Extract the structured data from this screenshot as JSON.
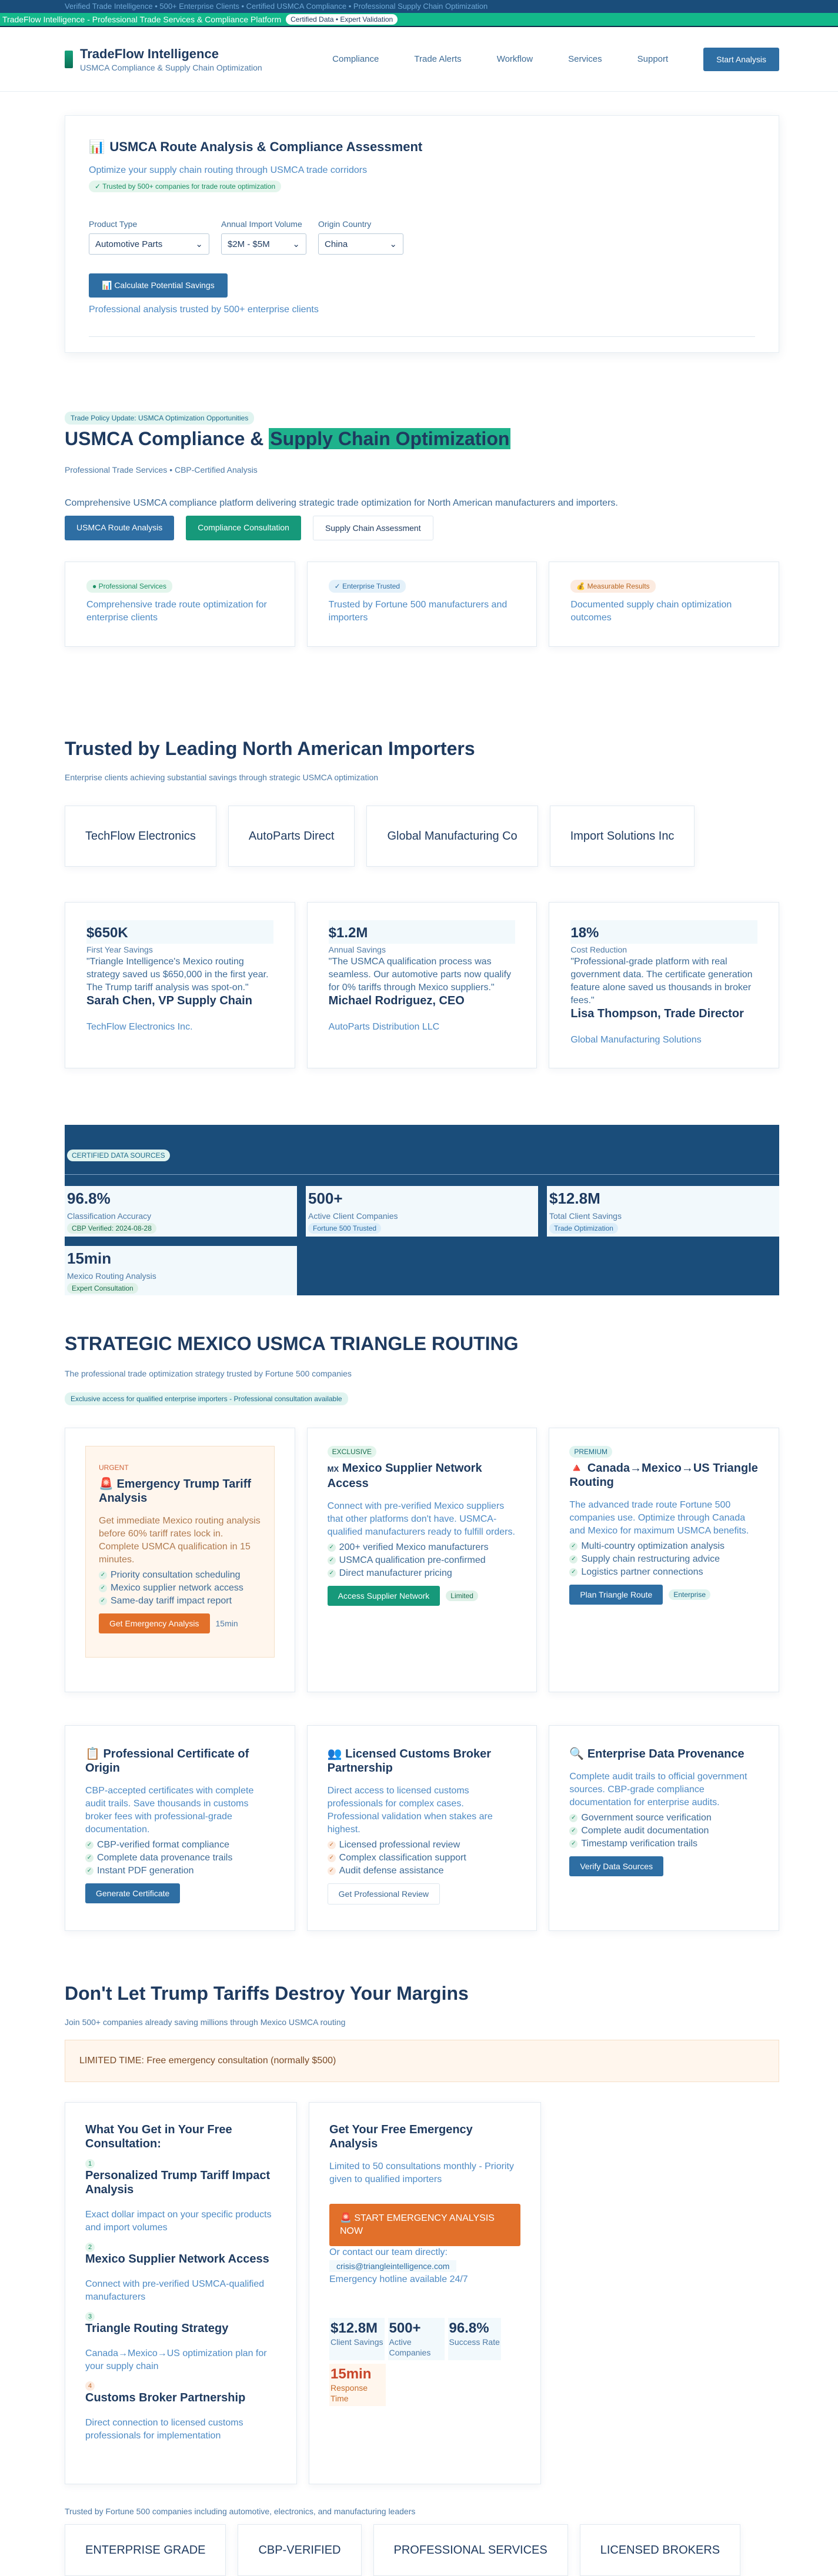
{
  "ribbons": {
    "top_text": "Verified Trade Intelligence • 500+ Enterprise Clients • Certified USMCA Compliance • Professional Supply Chain Optimization",
    "second_text": "TradeFlow Intelligence - Professional Trade Services & Compliance Platform",
    "second_chip": "Certified Data • Expert Validation"
  },
  "header": {
    "brand_name": "TradeFlow Intelligence",
    "brand_sub": "USMCA Compliance & Supply Chain Optimization",
    "nav": [
      "Compliance",
      "Trade Alerts",
      "Workflow",
      "Services",
      "Support"
    ],
    "cta": "Start Analysis"
  },
  "analysis": {
    "icon": "📊",
    "title": "USMCA Route Analysis & Compliance Assessment",
    "subtitle": "Optimize your supply chain routing through USMCA trade corridors",
    "trust_tag": "✓ Trusted by 500+ companies for trade route optimization",
    "fields": [
      {
        "label": "Product Type",
        "value": "Automotive Parts"
      },
      {
        "label": "Annual Import Volume",
        "value": "$2M - $5M"
      },
      {
        "label": "Origin Country",
        "value": "China"
      }
    ],
    "button": "📊 Calculate Potential Savings",
    "note": "Professional analysis trusted by 500+ enterprise clients"
  },
  "hero": {
    "badge": "Trade Policy Update: USMCA Optimization Opportunities",
    "title_a": "USMCA Compliance & ",
    "title_b": "Supply Chain Optimization",
    "meta": "Professional Trade Services • CBP-Certified Analysis",
    "desc": "Comprehensive USMCA compliance platform delivering strategic trade optimization for North American manufacturers and importers.",
    "buttons": [
      "USMCA Route Analysis",
      "Compliance Consultation",
      "Supply Chain Assessment"
    ],
    "features": [
      {
        "chip": "Professional Services",
        "text": "Comprehensive trade route optimization for enterprise clients"
      },
      {
        "chip": "Enterprise Trusted",
        "text": "Trusted by Fortune 500 manufacturers and importers"
      },
      {
        "chip": "Measurable Results",
        "text": "Documented supply chain optimization outcomes"
      }
    ]
  },
  "trusted": {
    "title": "Trusted by Leading North American Importers",
    "subtitle": "Enterprise clients achieving substantial savings through strategic USMCA optimization",
    "logos": [
      "TechFlow Electronics",
      "AutoParts Direct",
      "Global Manufacturing Co",
      "Import Solutions Inc"
    ],
    "testimonials": [
      {
        "value": "$650K",
        "label": "First Year Savings",
        "quote": "\"Triangle Intelligence's Mexico routing strategy saved us $650,000 in the first year. The Trump tariff analysis was spot-on.\"",
        "name": "Sarah Chen, VP Supply Chain",
        "company": "TechFlow Electronics Inc."
      },
      {
        "value": "$1.2M",
        "label": "Annual Savings",
        "quote": "\"The USMCA qualification process was seamless. Our automotive parts now qualify for 0% tariffs through Mexico suppliers.\"",
        "name": "Michael Rodriguez, CEO",
        "company": "AutoParts Distribution LLC"
      },
      {
        "value": "18%",
        "label": "Cost Reduction",
        "quote": "\"Professional-grade platform with real government data. The certificate generation feature alone saved us thousands in broker fees.\"",
        "name": "Lisa Thompson, Trade Director",
        "company": "Global Manufacturing Solutions"
      }
    ]
  },
  "data_band": {
    "chip": "CERTIFIED DATA SOURCES",
    "stats": [
      {
        "value": "96.8%",
        "label": "Classification Accuracy",
        "tag": "CBP Verified: 2024-08-28"
      },
      {
        "value": "500+",
        "label": "Active Client Companies",
        "tag": "Fortune 500 Trusted"
      },
      {
        "value": "$12.8M",
        "label": "Total Client Savings",
        "tag": "Trade Optimization"
      },
      {
        "value": "15min",
        "label": "Mexico Routing Analysis",
        "tag": "Expert Consultation"
      }
    ]
  },
  "strategic": {
    "title": "STRATEGIC MEXICO USMCA TRIANGLE ROUTING",
    "subtitle": "The professional trade optimization strategy trusted by Fortune 500 companies",
    "chip": "Exclusive access for qualified enterprise importers - Professional consultation available",
    "services": [
      {
        "badge": "URGENT",
        "icon": "🚨",
        "title": "Emergency Trump Tariff Analysis",
        "desc": "Get immediate Mexico routing analysis before 60% tariff rates lock in. Complete USMCA qualification in 15 minutes.",
        "items": [
          "Priority consultation scheduling",
          "Mexico supplier network access",
          "Same-day tariff impact report"
        ],
        "button": "Get Emergency Analysis",
        "note": "15min"
      },
      {
        "badge": "EXCLUSIVE",
        "icon": "MX",
        "title": "Mexico Supplier Network Access",
        "desc": "Connect with pre-verified Mexico suppliers that other platforms don't have. USMCA-qualified manufacturers ready to fulfill orders.",
        "items": [
          "200+ verified Mexico manufacturers",
          "USMCA qualification pre-confirmed",
          "Direct manufacturer pricing"
        ],
        "button": "Access Supplier Network",
        "note": "Limited"
      },
      {
        "badge": "PREMIUM",
        "icon": "🔺",
        "title": "Canada→Mexico→US Triangle Routing",
        "desc": "The advanced trade route Fortune 500 companies use. Optimize through Canada and Mexico for maximum USMCA benefits.",
        "items": [
          "Multi-country optimization analysis",
          "Supply chain restructuring advice",
          "Logistics partner connections"
        ],
        "button": "Plan Triangle Route",
        "note": "Enterprise"
      }
    ],
    "services2": [
      {
        "icon": "📋",
        "title": "Professional Certificate of Origin",
        "desc": "CBP-accepted certificates with complete audit trails. Save thousands in customs broker fees with professional-grade documentation.",
        "items": [
          "CBP-verified format compliance",
          "Complete data provenance trails",
          "Instant PDF generation"
        ],
        "button": "Generate Certificate"
      },
      {
        "icon": "👥",
        "title": "Licensed Customs Broker Partnership",
        "desc": "Direct access to licensed customs professionals for complex cases. Professional validation when stakes are highest.",
        "items": [
          "Licensed professional review",
          "Complex classification support",
          "Audit defense assistance"
        ],
        "button": "Get Professional Review"
      },
      {
        "icon": "🔍",
        "title": "Enterprise Data Provenance",
        "desc": "Complete audit trails to official government sources. CBP-grade compliance documentation for enterprise audits.",
        "items": [
          "Government source verification",
          "Complete audit documentation",
          "Timestamp verification trails"
        ],
        "button": "Verify Data Sources"
      }
    ]
  },
  "dontlet": {
    "title": "Don't Let Trump Tariffs Destroy Your Margins",
    "subtitle": "Join 500+ companies already saving millions through Mexico USMCA routing",
    "limited": "LIMITED TIME: Free emergency consultation (normally $500)",
    "left_title": "What You Get in Your Free Consultation:",
    "steps": [
      {
        "num": "1",
        "title": "Personalized Trump Tariff Impact Analysis",
        "desc": "Exact dollar impact on your specific products and import volumes"
      },
      {
        "num": "2",
        "title": "Mexico Supplier Network Access",
        "desc": "Connect with pre-verified USMCA-qualified manufacturers"
      },
      {
        "num": "3",
        "title": "Triangle Routing Strategy",
        "desc": "Canada→Mexico→US optimization plan for your supply chain"
      },
      {
        "num": "4",
        "title": "Customs Broker Partnership",
        "desc": "Direct connection to licensed customs professionals for implementation"
      }
    ],
    "right_title": "Get Your Free Emergency Analysis",
    "right_sub": "Limited to 50 consultations monthly - Priority given to qualified importers",
    "cta": "🚨 START EMERGENCY ANALYSIS NOW",
    "contact_label": "Or contact our team directly:",
    "email": "crisis@triangleintelligence.com",
    "hotline": "Emergency hotline available 24/7",
    "stats": [
      {
        "value": "$12.8M",
        "label": "Client Savings"
      },
      {
        "value": "500+",
        "label": "Active Companies"
      },
      {
        "value": "96.8%",
        "label": "Success Rate"
      },
      {
        "value": "15min",
        "label": "Response Time"
      }
    ]
  },
  "footer": {
    "note": "Trusted by Fortune 500 companies including automotive, electronics, and manufacturing leaders",
    "certs": [
      "ENTERPRISE GRADE",
      "CBP-VERIFIED",
      "PROFESSIONAL SERVICES",
      "LICENSED BROKERS"
    ]
  }
}
